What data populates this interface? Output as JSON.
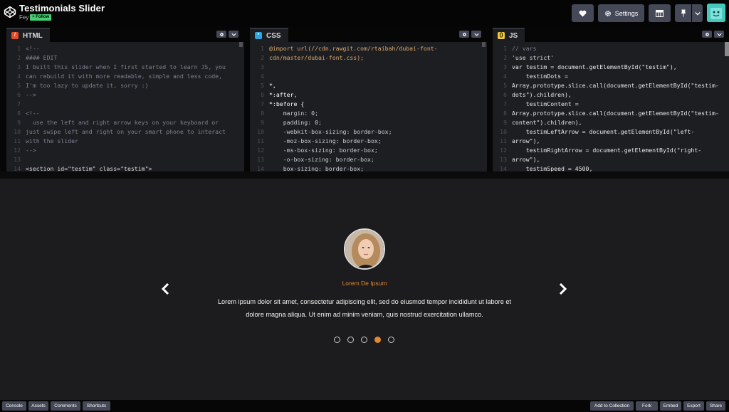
{
  "header": {
    "title": "Testimonials Slider",
    "author": "Fey",
    "follow_label": "+ Follow",
    "settings_label": "Settings"
  },
  "editors": {
    "html": {
      "label": "HTML",
      "badge_color": "#e44d26",
      "line_numbers": [
        "1",
        "2",
        "3",
        "4",
        "5",
        "6",
        "7",
        "8",
        "9",
        "10",
        "11",
        "12",
        "13",
        "14"
      ],
      "lines": [
        "<!--",
        "#### EDIT",
        "I built this slider when I first started to learn JS, you",
        "can rebuild it with more readable, simple and less code,",
        "I'm too lazy to update it, sorry :)",
        "-->",
        "",
        "<!--",
        "  use the left and right arrow keys on your keyboard or",
        "just swipe left and right on your smart phone to interact",
        "with the slider",
        "-->",
        "",
        "<section id=\"testim\" class=\"testim\">"
      ]
    },
    "css": {
      "label": "CSS",
      "badge_color": "#2aa7e0",
      "line_numbers": [
        "1",
        "2",
        "3",
        "4",
        "5",
        "6",
        "7",
        "8",
        "9",
        "10",
        "11",
        "12",
        "13",
        "14"
      ],
      "lines": [
        "@import url(//cdn.rawgit.com/rtaibah/dubai-font-",
        "cdn/master/dubai-font.css);",
        "",
        "",
        "*,",
        "*:after,",
        "*:before {",
        "    margin: 0;",
        "    padding: 0;",
        "    -webkit-box-sizing: border-box;",
        "    -moz-box-sizing: border-box;",
        "    -ms-box-sizing: border-box;",
        "    -o-box-sizing: border-box;",
        "    box-sizing: border-box;"
      ]
    },
    "js": {
      "label": "JS",
      "badge_color": "#f0c93a",
      "line_numbers": [
        "1",
        "2",
        "3",
        "4",
        "5",
        "6",
        "7",
        "8",
        "9",
        "10",
        "11",
        "12",
        "13",
        "14"
      ],
      "lines": [
        "// vars",
        "'use strict'",
        "var testim = document.getElementById(\"testim\"),",
        "    testimDots =",
        "Array.prototype.slice.call(document.getElementById(\"testim-",
        "dots\").children),",
        "    testimContent =",
        "Array.prototype.slice.call(document.getElementById(\"testim-",
        "content\").children),",
        "    testimLeftArrow = document.getElementById(\"left-",
        "arrow\"),",
        "    testimRightArrow = document.getElementById(\"right-",
        "arrow\"),",
        "    testimSpeed = 4500,"
      ]
    }
  },
  "preview": {
    "name": "Lorem De Ipsum",
    "text": "Lorem ipsum dolor sit amet, consectetur adipiscing elit, sed do eiusmod tempor incididunt ut labore et dolore magna aliqua. Ut enim ad minim veniam, quis nostrud exercitation ullamco.",
    "dot_count": 5,
    "active_dot": 4,
    "accent_color": "#e4882e"
  },
  "footer": {
    "left": [
      "Console",
      "Assets",
      "Comments",
      "Shortcuts"
    ],
    "right": [
      "Add to Collection",
      "Fork",
      "Embed",
      "Export",
      "Share"
    ]
  },
  "icons": {
    "logo": "codepen-logo-icon",
    "heart": "heart-icon",
    "settings": "gear-icon",
    "layout": "layout-icon",
    "pin": "pin-icon",
    "caret": "chevron-down-icon",
    "prev": "chevron-left-icon",
    "next": "chevron-right-icon"
  }
}
